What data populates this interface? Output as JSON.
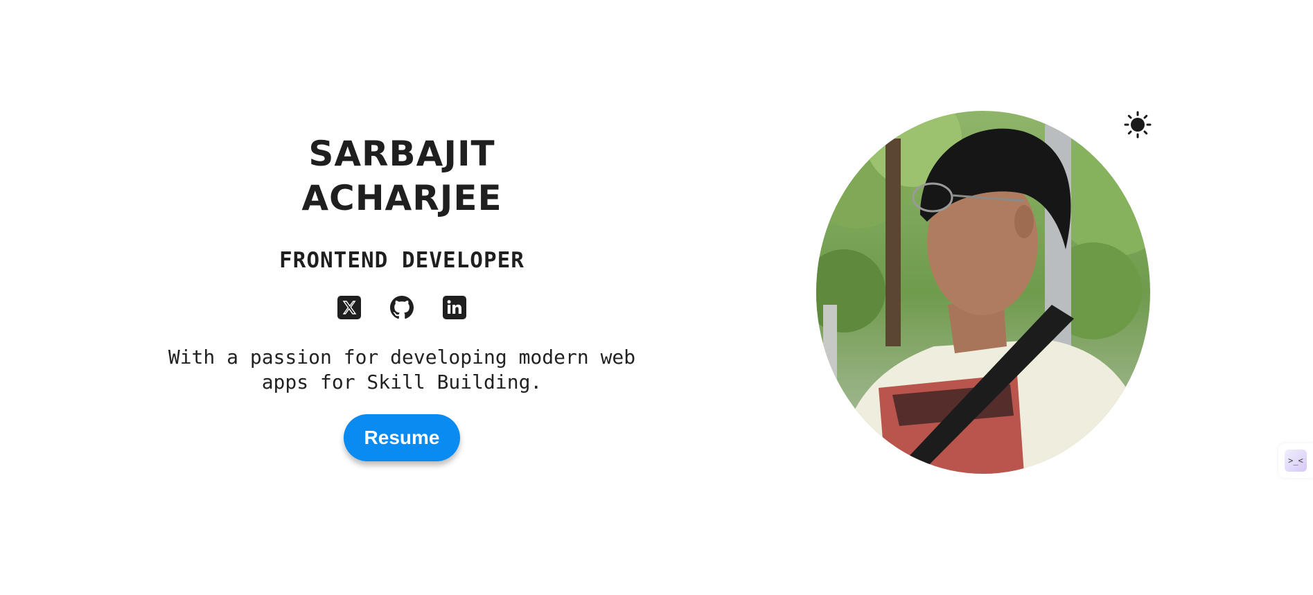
{
  "hero": {
    "name_line1": "SARBAJIT",
    "name_line2": "ACHARJEE",
    "role": "FRONTEND DEVELOPER",
    "tagline_line1": "With a passion for developing modern web",
    "tagline_line2": "apps for Skill Building.",
    "resume_label": "Resume"
  },
  "socials": [
    {
      "icon": "x-twitter-icon"
    },
    {
      "icon": "github-icon"
    },
    {
      "icon": "linkedin-icon"
    }
  ],
  "theme_toggle": {
    "icon": "sun-icon"
  },
  "widget": {
    "icon": "face-icon",
    "glyph": ">_<"
  },
  "colors": {
    "text": "#1f1f1f",
    "accent": "#0a8bf2",
    "background": "#ffffff"
  }
}
